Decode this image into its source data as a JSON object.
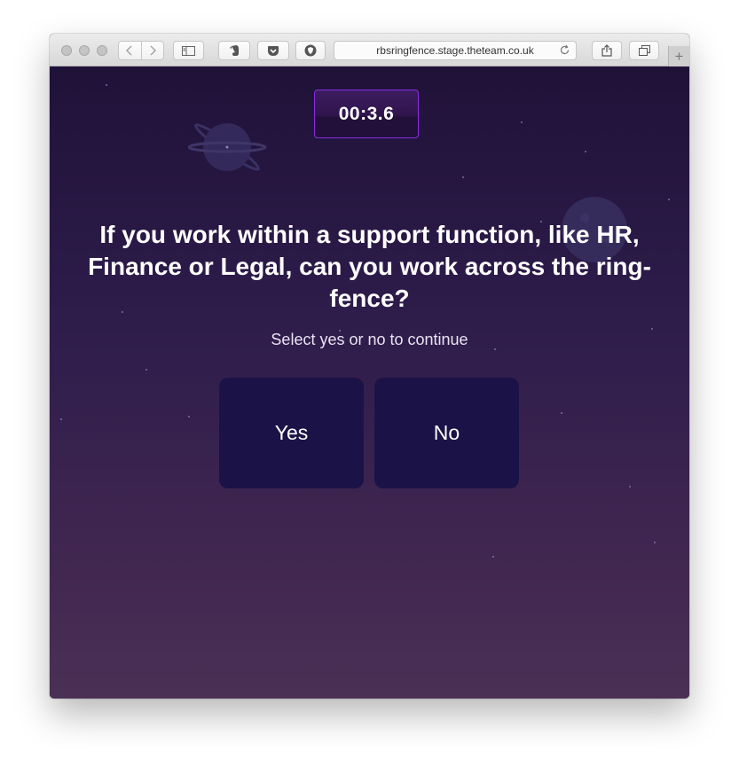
{
  "browser": {
    "url": "rbsringfence.stage.theteam.co.uk",
    "icons": [
      "back-icon",
      "forward-icon",
      "sidebar-icon",
      "evernote-icon",
      "pocket-icon",
      "extension-shield-icon",
      "reload-icon",
      "share-icon",
      "tabs-icon",
      "new-tab-icon"
    ]
  },
  "quiz": {
    "timer": "00:3.6",
    "question": "If you work within a support function, like HR, Finance or Legal, can you work across the ring-fence?",
    "instruction": "Select yes or no to continue",
    "answers": {
      "yes": "Yes",
      "no": "No"
    }
  },
  "colors": {
    "background_top": "#1f1238",
    "background_bottom": "#4b3055",
    "timer_border": "#8a2ce0",
    "answer_button": "#1b1347"
  }
}
